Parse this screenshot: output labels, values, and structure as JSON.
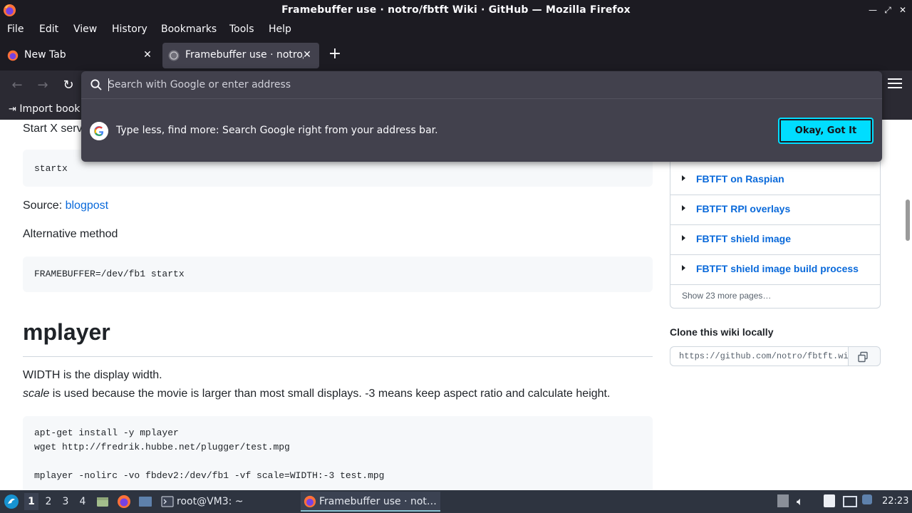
{
  "window": {
    "title": "Framebuffer use · notro/fbtft Wiki · GitHub — Mozilla Firefox"
  },
  "menu": {
    "file": "File",
    "edit": "Edit",
    "view": "View",
    "history": "History",
    "bookmarks": "Bookmarks",
    "tools": "Tools",
    "help": "Help"
  },
  "tabs": [
    {
      "label": "New Tab"
    },
    {
      "label": "Framebuffer use · notro/fb"
    }
  ],
  "bookmarks_bar": {
    "import_label": "Import book"
  },
  "urlbar": {
    "placeholder": "Search with Google or enter address",
    "tip": "Type less, find more: Search Google right from your address bar.",
    "ok_button": "Okay, Got It"
  },
  "article": {
    "start_x": "Start X serv",
    "code1": "startx",
    "source_label": "Source:",
    "source_link": "blogpost",
    "alt_method": "Alternative method",
    "code2": "FRAMEBUFFER=/dev/fb1 startx",
    "heading_mplayer": "mplayer",
    "width_text": "WIDTH is the display width.",
    "scale_word": "scale",
    "scale_text": " is used because the movie is larger than most small displays. -3 means keep aspect ratio and calculate height.",
    "code3_lines": [
      "apt-get install -y mplayer",
      "wget http://fredrik.hubbe.net/plugger/test.mpg",
      "",
      "mplayer -nolirc -vo fbdev2:/dev/fb1 -vf scale=WIDTH:-3 test.mpg"
    ]
  },
  "sidebar": {
    "pages": [
      {
        "label": "FBTFT on Raspian"
      },
      {
        "label": "FBTFT RPI overlays"
      },
      {
        "label": "FBTFT shield image"
      },
      {
        "label": "FBTFT shield image build process"
      }
    ],
    "more_pages": "Show 23 more pages…",
    "clone_title": "Clone this wiki locally",
    "clone_url": "https://github.com/notro/fbtft.wiki.git"
  },
  "taskbar": {
    "workspaces": [
      "1",
      "2",
      "3",
      "4"
    ],
    "terminal_task": "root@VM3: ~",
    "firefox_task": "Framebuffer use · not…",
    "clock": "22:23"
  },
  "colors": {
    "accent_cyan": "#00ddff",
    "link_blue": "#0969da",
    "chrome_dark": "#1c1b22"
  }
}
